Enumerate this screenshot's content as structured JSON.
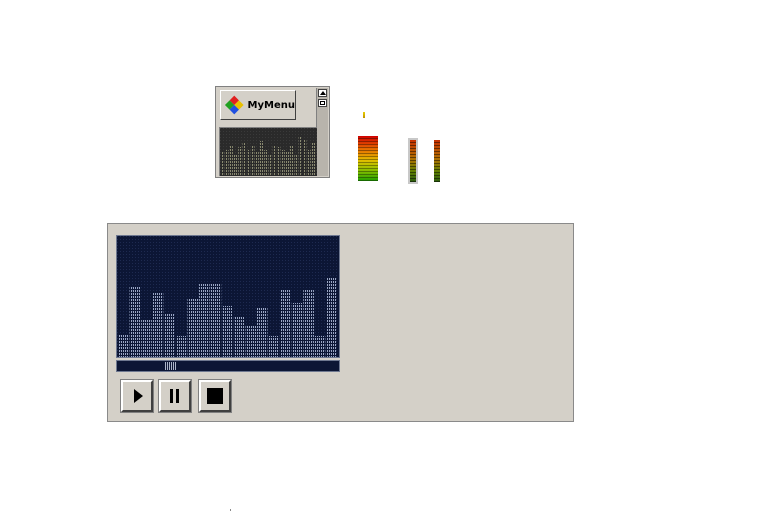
{
  "mini_widget": {
    "menu_button_label": "MyMenu",
    "menu_icon": "colored-diamond-icon",
    "spectrum_levels": [
      0.55,
      0.6,
      0.7,
      0.5,
      0.65,
      0.75,
      0.6,
      0.7,
      0.55,
      0.8,
      0.6,
      0.5,
      0.7,
      0.65,
      0.6,
      0.55,
      0.7,
      0.5,
      0.9,
      0.85,
      0.6,
      0.75
    ]
  },
  "level_meters": {
    "main_level": 0.95,
    "left_level": 0.95,
    "right_level": 0.9
  },
  "player": {
    "spectrum_levels": [
      0.2,
      0.6,
      0.32,
      0.55,
      0.38,
      0.18,
      0.5,
      0.63,
      0.62,
      0.44,
      0.35,
      0.27,
      0.43,
      0.18,
      0.58,
      0.46,
      0.58,
      0.18,
      0.68
    ],
    "seek_position": 0.23,
    "buttons": {
      "play_icon": "play-icon",
      "pause_icon": "pause-icon",
      "stop_icon": "stop-icon"
    },
    "colors": {
      "panel_bg": "#d4d0c8",
      "display_bg": "#0c1635",
      "bar_color": "#8a96b4"
    }
  }
}
